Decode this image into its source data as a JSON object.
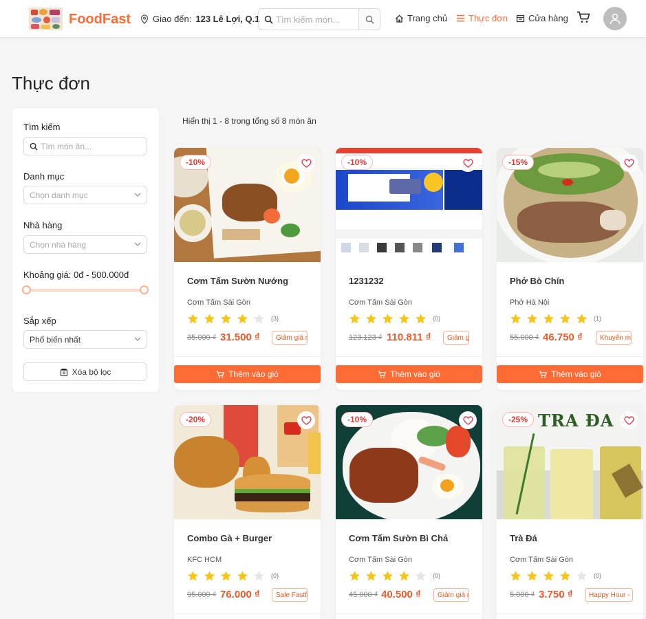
{
  "header": {
    "brand": "FoodFast",
    "deliver_label": "Giao đến:",
    "deliver_address": "123 Lê Lợi, Q.1",
    "search_placeholder": "Tìm kiếm món...",
    "nav": [
      {
        "label": "Trang chủ",
        "icon": "home-icon"
      },
      {
        "label": "Thực đơn",
        "icon": "menu-icon",
        "active": true
      },
      {
        "label": "Cửa hàng",
        "icon": "store-icon"
      }
    ],
    "accent_color": "#ff6b35"
  },
  "page_title": "Thực đơn",
  "filters": {
    "search_label": "Tìm kiếm",
    "search_placeholder": "Tìm món ăn...",
    "category_label": "Danh mục",
    "category_placeholder": "Chọn danh mục",
    "restaurant_label": "Nhà hàng",
    "restaurant_placeholder": "Chọn nhà hàng",
    "price_label": "Khoảng giá: 0đ - 500.000đ",
    "price_range_fraction": [
      0,
      1
    ],
    "sort_label": "Sắp xếp",
    "sort_value": "Phổ biến nhất",
    "clear_label": "Xóa bộ lọc"
  },
  "results_count": "Hiển thị 1 - 8 trong tổng số 8 món ăn",
  "add_to_cart_label": "Thêm vào giỏ",
  "products": [
    {
      "name": "Cơm Tấm Sườn Nướng",
      "restaurant": "Cơm Tấm Sài Gòn",
      "discount": "-10%",
      "rating": 4,
      "reviews": "(3)",
      "old_price": "35.000 ₫",
      "price": "31.500 ₫",
      "promo": "Giảm giá m"
    },
    {
      "name": "1231232",
      "restaurant": "Cơm Tấm Sài Gòn",
      "discount": "-10%",
      "rating": 5,
      "reviews": "(0)",
      "old_price": "123.123 ₫",
      "price": "110.811 ₫",
      "promo": "Giảm g"
    },
    {
      "name": "Phở Bò Chín",
      "restaurant": "Phở Hà Nội",
      "discount": "-15%",
      "rating": 5,
      "reviews": "(1)",
      "old_price": "55.000 ₫",
      "price": "46.750 ₫",
      "promo": "Khuyến m"
    },
    {
      "name": "Combo Gà + Burger",
      "restaurant": "KFC HCM",
      "discount": "-20%",
      "rating": 4,
      "reviews": "(0)",
      "old_price": "95.000 ₫",
      "price": "76.000 ₫",
      "promo": "Sale Fastfo"
    },
    {
      "name": "Cơm Tấm Sườn Bì Chả",
      "restaurant": "Cơm Tấm Sài Gòn",
      "discount": "-10%",
      "rating": 4,
      "reviews": "(0)",
      "old_price": "45.000 ₫",
      "price": "40.500 ₫",
      "promo": "Giảm giá n"
    },
    {
      "name": "Trà Đá",
      "restaurant": "Cơm Tấm Sài Gòn",
      "discount": "-25%",
      "rating": 4,
      "reviews": "(0)",
      "old_price": "5.000 ₫",
      "price": "3.750 ₫",
      "promo": "Happy Hour -",
      "image_text": "TRA ĐA"
    }
  ]
}
